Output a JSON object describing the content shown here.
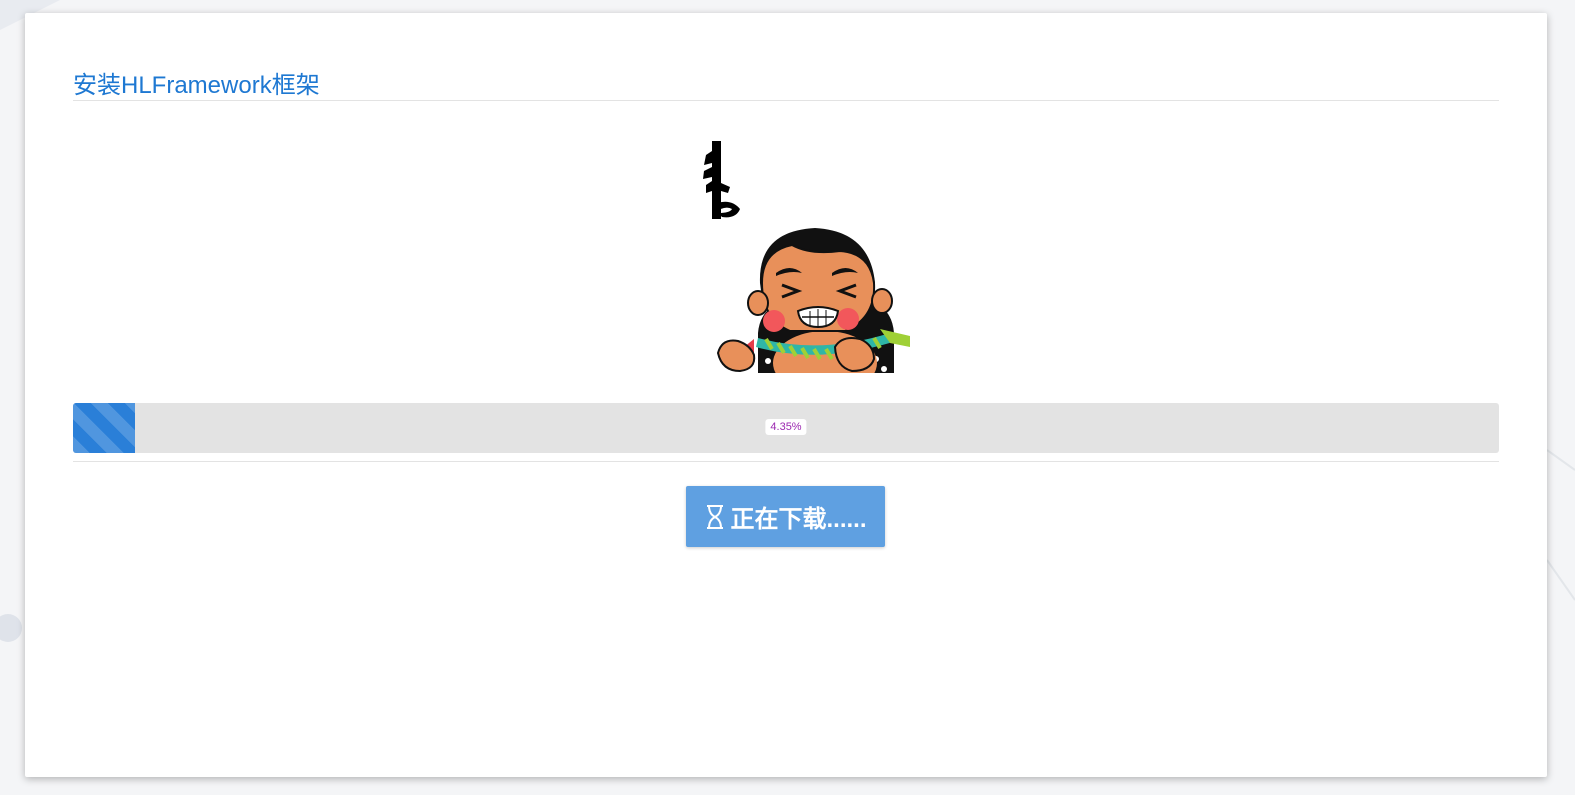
{
  "dialog": {
    "title": "安装HLFramework框架"
  },
  "progress": {
    "percent": 4.35,
    "label": "4.35%",
    "bar_color": "#2a7fd8",
    "label_color": "#9b27b0"
  },
  "action_button": {
    "icon": "hourglass-icon",
    "label": "正在下载......",
    "color": "#5fa0e1"
  },
  "colors": {
    "accent": "#1e78d2"
  }
}
